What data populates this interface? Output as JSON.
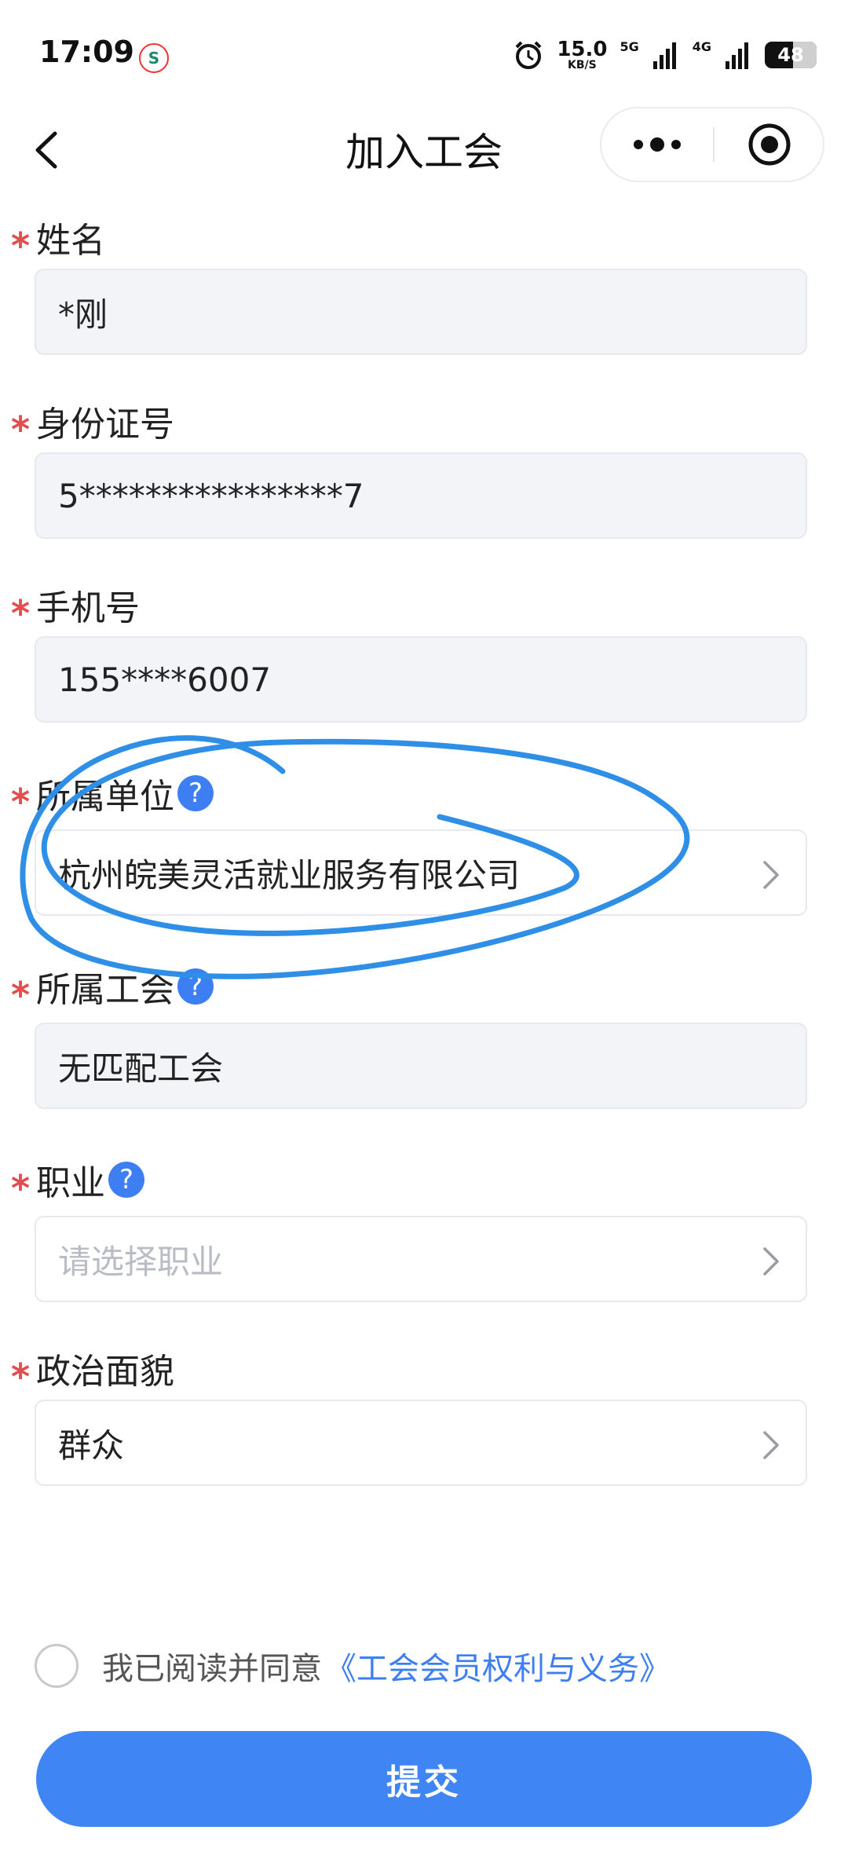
{
  "status_bar": {
    "time": "17:09",
    "net_speed_value": "15.0",
    "net_speed_unit": "KB/S",
    "signal1_label": "5G",
    "signal2_label": "4G",
    "battery_level": "48",
    "icons": [
      "app-notification-icon",
      "alarm-icon",
      "signal-icon",
      "battery-icon"
    ]
  },
  "nav": {
    "title": "加入工会"
  },
  "form": {
    "name": {
      "label": "姓名",
      "value": "*刚"
    },
    "id_number": {
      "label": "身份证号",
      "value": "5****************7"
    },
    "phone": {
      "label": "手机号",
      "value": "155****6007"
    },
    "employer": {
      "label": "所属单位",
      "value": "杭州皖美灵活就业服务有限公司"
    },
    "union": {
      "label": "所属工会",
      "value": "无匹配工会"
    },
    "occupation": {
      "label": "职业",
      "placeholder": "请选择职业"
    },
    "political_status": {
      "label": "政治面貌",
      "value": "群众"
    },
    "required_mark": "*",
    "help_mark": "?"
  },
  "agreement": {
    "text": "我已阅读并同意",
    "link": "《工会会员权利与义务》",
    "checked": false
  },
  "submit_label": "提交",
  "colors": {
    "accent": "#3f86f4",
    "required": "#e34d4d",
    "annotation": "#2f8fe6",
    "readonly_bg": "#f3f4f8"
  }
}
